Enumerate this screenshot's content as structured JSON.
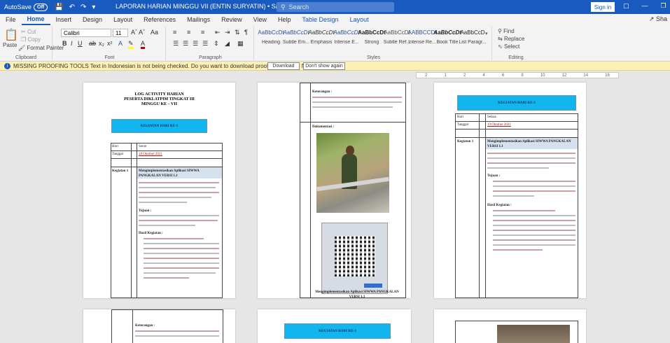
{
  "titlebar": {
    "autosave_label": "AutoSave",
    "autosave_state": "Off",
    "doc_title": "LAPORAN HARIAN MINGGU VII (ENTIN SURYATIN) • Saved to this PC ∨",
    "search_placeholder": "Search",
    "signin": "Sign in"
  },
  "tabs": [
    "File",
    "Home",
    "Insert",
    "Design",
    "Layout",
    "References",
    "Mailings",
    "Review",
    "View",
    "Help",
    "Table Design",
    "Layout"
  ],
  "share": "Sha",
  "ribbon": {
    "clipboard": {
      "paste": "Paste",
      "cut": "Cut",
      "copy": "Copy",
      "format_painter": "Format Painter",
      "label": "Clipboard"
    },
    "font": {
      "name": "Calibri",
      "size": "11",
      "label": "Font"
    },
    "paragraph": {
      "label": "Paragraph"
    },
    "styles": {
      "label": "Styles",
      "items": [
        {
          "sample": "AaBbCcDt",
          "name": "Heading"
        },
        {
          "sample": "AaBbCcDt",
          "name": "Subtle Em..."
        },
        {
          "sample": "AaBbCcDt",
          "name": "Emphasis"
        },
        {
          "sample": "AaBbCcDt",
          "name": "Intense E..."
        },
        {
          "sample": "AaBbCcDt",
          "name": "Strong"
        },
        {
          "sample": "AaBbCcDt",
          "name": "Subtle Ref..."
        },
        {
          "sample": "AABBCCDI",
          "name": "Intense Re..."
        },
        {
          "sample": "AaBbCcDt",
          "name": "Book Title"
        },
        {
          "sample": "AaBbCcD",
          "name": "List Paragr..."
        }
      ]
    },
    "editing": {
      "find": "Find",
      "replace": "Replace",
      "select": "Select",
      "label": "Editing"
    }
  },
  "infobar": {
    "icon": "i",
    "message": "MISSING PROOFING TOOLS  Text in Indonesian is not being checked. Do you want to download proofing tools and future updates?",
    "download": "Download",
    "dismiss": "Don't show again"
  },
  "ruler": [
    "2",
    "1",
    "2",
    "4",
    "6",
    "8",
    "10",
    "12",
    "14",
    "16"
  ],
  "page1": {
    "title1": "LOG ACTIVITY HARIAN",
    "title2": "PESERTA DIKLATPIM TINGKAT III",
    "title3": "MINGGU KE – VII",
    "box": "KEGIATAN HARI KE-1",
    "hari_label": "Hari",
    "hari_value": "Senin",
    "tanggal_label": "Tanggal",
    "tanggal_value": "18 Oktober 2021",
    "kegiatan_label": "Kegiatan 1",
    "kegiatan_value": "Mengimplementasikan Aplikasi SIWWA PANGKALAN VERSI 1.1",
    "tujuan": "Tujuan :",
    "hasil": "Hasil Kegiatan :"
  },
  "page2": {
    "keterangan": "Keterangan :",
    "dokumentasi": "Dokumentasi :",
    "caption": "Mengimplementasikan Aplikasi SIWWA PANGKALAN VERSI 1.1"
  },
  "page3": {
    "box": "KEGIATAN HARI KE-2",
    "hari_label": "Hari",
    "hari_value": "Selasa",
    "tanggal_label": "Tanggal",
    "tanggal_value": "19 Oktober 2021",
    "kegiatan_label": "Kegiatan 1",
    "kegiatan_value": "Mengimplementasikan Aplikasi SIWWA PANGKALAN VERSI 1.1",
    "tujuan": "Tujuan :",
    "hasil": "Hasil Kegiatan :"
  },
  "page4": {
    "keterangan": "Keterangan :"
  },
  "page5": {
    "box": "KEGIATAN HARI KE-3"
  }
}
